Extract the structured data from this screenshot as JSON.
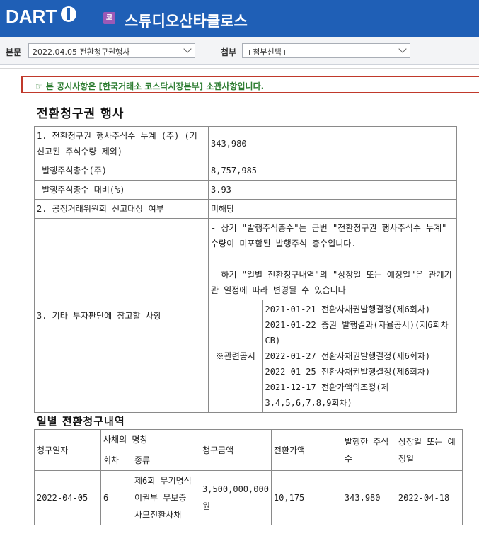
{
  "header": {
    "logo": "DART",
    "company_badge": "코",
    "company_name": "스튜디오산타클로스"
  },
  "selector": {
    "report_label": "본문",
    "report_value": "2022.04.05  전환청구권행사",
    "attach_label": "첨부",
    "attach_value": "+첨부선택+"
  },
  "notice": "☞ 본 공시사항은 [한국거래소 코스닥시장본부] 소관사항입니다.",
  "title": "전환청구권 행사",
  "summary": {
    "row1_label": "1. 전환청구권 행사주식수 누계 (주) (기 신고된 주식수량 제외)",
    "row1_value": "343,980",
    "row2_label": "-발행주식총수(주)",
    "row2_value": "8,757,985",
    "row3_label": "-발행주식총수 대비(%)",
    "row3_value": "3.93",
    "row4_label": "2. 공정거래위원회 신고대상 여부",
    "row4_value": "미해당",
    "row5_label": "3. 기타 투자판단에 참고할 사항",
    "note1": "- 상기 \"발행주식총수\"는 금번 \"전환청구권 행사주식수 누계\" 수량이 미포함된 발행주식 총수입니다.",
    "note2": "- 하기 \"일별 전환청구내역\"의 \"상장일 또는 예정일\"은 관계기관 일정에 따라 변경될 수 있습니다",
    "related_label": "※관련공시",
    "related": [
      "2021-01-21 전환사채권발행결정(제6회차)",
      "2021-01-22 증권 발행결과(자율공시)(제6회차 CB)",
      "2022-01-27 전환사채권발행결정(제6회차)",
      "2022-01-25 전환사채권발행결정(제6회차)",
      "2021-12-17 전환가액의조정(제3,4,5,6,7,8,9회차)"
    ]
  },
  "daily_title": "일별 전환청구내역",
  "daily_table": {
    "headers": {
      "date": "청구일자",
      "bond_name": "사채의 명칭",
      "round": "회차",
      "kind": "종류",
      "amount": "청구금액",
      "price": "전환가액",
      "shares": "발행한 주식수",
      "listing": "상장일 또는 예정일"
    },
    "rows": [
      {
        "date": "2022-04-05",
        "round": "6",
        "kind": "제6회 무기명식 이권부 무보증 사모전환사채",
        "amount": "3,500,000,000원",
        "price": "10,175",
        "shares": "343,980",
        "listing": "2022-04-18"
      }
    ]
  }
}
